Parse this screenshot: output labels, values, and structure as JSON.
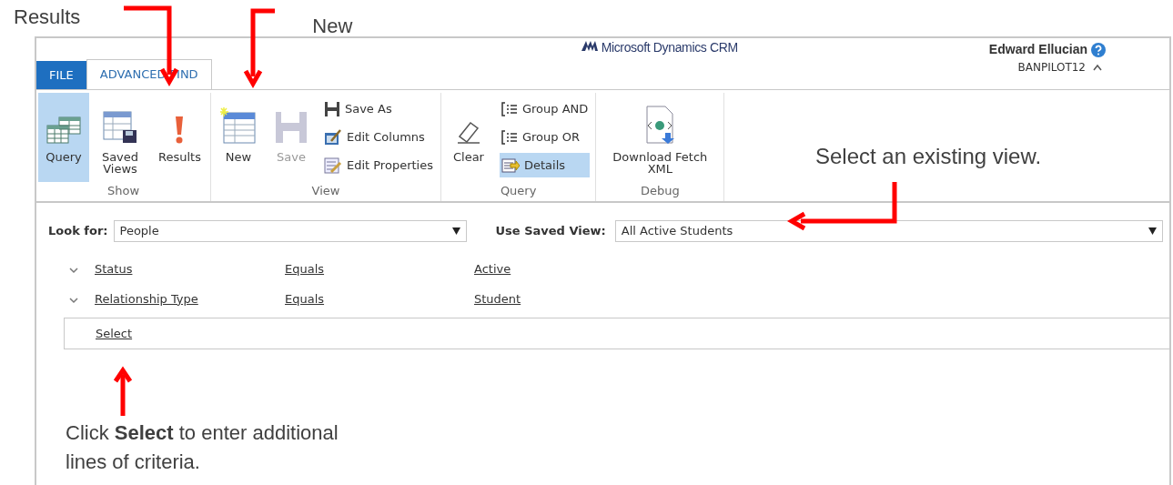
{
  "callouts": {
    "results_label": "Results",
    "new_label": "New",
    "view_hint": "Select an existing view.",
    "select_hint": "Click **Select** to enter additional lines of criteria."
  },
  "header": {
    "logo": "Microsoft Dynamics CRM",
    "user": "Edward Ellucian",
    "org": "BANPILOT12"
  },
  "tabs": [
    {
      "label": "FILE",
      "kind": "file",
      "selected": false
    },
    {
      "label": "ADVANCED FIND",
      "kind": "tab",
      "selected": true
    }
  ],
  "ribbon": [
    {
      "label": "Show",
      "items": [
        {
          "kind": "large",
          "label": "Query",
          "selected": true,
          "disabled": false
        },
        {
          "kind": "large",
          "label": "Saved Views",
          "selected": false,
          "disabled": false
        },
        {
          "kind": "large",
          "label": "Results",
          "selected": false,
          "disabled": false
        }
      ]
    },
    {
      "label": "View",
      "items": [
        {
          "kind": "large",
          "label": "New",
          "selected": false,
          "disabled": false
        },
        {
          "kind": "large",
          "label": "Save",
          "selected": false,
          "disabled": true
        },
        {
          "kind": "stack",
          "items": [
            {
              "label": "Save As",
              "selected": false
            },
            {
              "label": "Edit Columns",
              "selected": false
            },
            {
              "label": "Edit Properties",
              "selected": false
            }
          ]
        }
      ]
    },
    {
      "label": "Query",
      "items": [
        {
          "kind": "large",
          "label": "Clear",
          "selected": false,
          "disabled": false
        },
        {
          "kind": "stack",
          "items": [
            {
              "label": "Group AND",
              "selected": false
            },
            {
              "label": "Group OR",
              "selected": false
            },
            {
              "label": "Details",
              "selected": true
            }
          ]
        }
      ]
    },
    {
      "label": "Debug",
      "items": [
        {
          "kind": "large",
          "label": "Download Fetch XML",
          "selected": false,
          "disabled": false
        }
      ]
    }
  ],
  "look_for": {
    "label": "Look for:",
    "value": "People"
  },
  "saved_view": {
    "label": "Use Saved View:",
    "value": "All Active Students"
  },
  "criteria": [
    {
      "field": "Status",
      "operator": "Equals",
      "value": "Active"
    },
    {
      "field": "Relationship Type",
      "operator": "Equals",
      "value": "Student"
    }
  ],
  "select_link": "Select"
}
